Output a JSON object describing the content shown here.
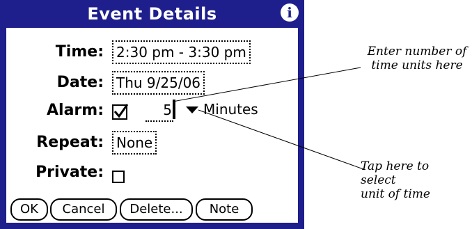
{
  "window": {
    "title": "Event Details",
    "info_icon": "info-icon"
  },
  "form": {
    "time_label": "Time:",
    "time_value": "2:30 pm - 3:30 pm",
    "date_label": "Date:",
    "date_value": "Thu 9/25/06",
    "alarm_label": "Alarm:",
    "alarm_checked": true,
    "alarm_value": "5",
    "alarm_unit": "Minutes",
    "repeat_label": "Repeat:",
    "repeat_value": "None",
    "private_label": "Private:",
    "private_checked": false
  },
  "buttons": {
    "ok": "OK",
    "cancel": "Cancel",
    "delete": "Delete...",
    "note": "Note"
  },
  "annotations": {
    "enter_line1": "Enter number of",
    "enter_line2": "time units here",
    "tap_line1": "Tap here to select",
    "tap_line2": "unit of time"
  },
  "colors": {
    "header": "#1e1e8c",
    "panel": "#ffffff"
  }
}
